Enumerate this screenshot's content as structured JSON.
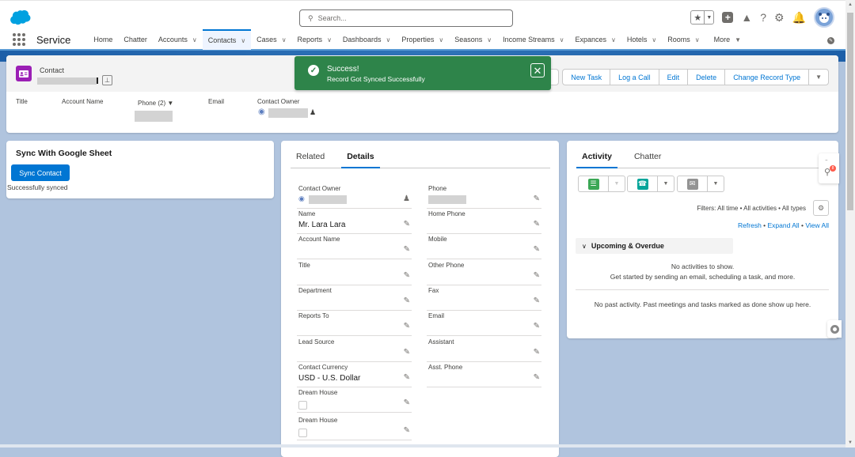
{
  "header": {
    "search_placeholder": "Search...",
    "icons": [
      "favorites-star-icon",
      "favorites-dropdown-icon",
      "global-add-icon",
      "trailhead-icon",
      "help-icon",
      "setup-gear-icon",
      "notifications-bell-icon",
      "user-avatar"
    ]
  },
  "nav": {
    "app_name": "Service",
    "items": [
      {
        "label": "Home",
        "dropdown": false
      },
      {
        "label": "Chatter",
        "dropdown": false
      },
      {
        "label": "Accounts",
        "dropdown": true
      },
      {
        "label": "Contacts",
        "dropdown": true,
        "active": true
      },
      {
        "label": "Cases",
        "dropdown": true
      },
      {
        "label": "Reports",
        "dropdown": true
      },
      {
        "label": "Dashboards",
        "dropdown": true
      },
      {
        "label": "Properties",
        "dropdown": true
      },
      {
        "label": "Seasons",
        "dropdown": true
      },
      {
        "label": "Income Streams",
        "dropdown": true
      },
      {
        "label": "Expances",
        "dropdown": true
      },
      {
        "label": "Hotels",
        "dropdown": true
      },
      {
        "label": "Rooms",
        "dropdown": true
      }
    ],
    "more_label": "More"
  },
  "record": {
    "object_label": "Contact",
    "actions": [
      "New Task",
      "Log a Call",
      "Edit",
      "Delete",
      "Change Record Type"
    ],
    "highlights": {
      "title_label": "Title",
      "account_label": "Account Name",
      "phone_label": "Phone (2)",
      "email_label": "Email",
      "owner_label": "Contact Owner"
    }
  },
  "toast": {
    "title": "Success!",
    "message": "Record Got Synced Successfully",
    "color": "#2e844a"
  },
  "sync": {
    "title": "Sync With Google Sheet",
    "button_label": "Sync Contact",
    "status": "Successfully synced"
  },
  "details": {
    "tabs": [
      "Related",
      "Details"
    ],
    "active_tab": "Details",
    "left_fields": [
      {
        "label": "Contact Owner",
        "value": ""
      },
      {
        "label": "Name",
        "value": "Mr. Lara Lara"
      },
      {
        "label": "Account Name",
        "value": ""
      },
      {
        "label": "Title",
        "value": ""
      },
      {
        "label": "Department",
        "value": ""
      },
      {
        "label": "Reports To",
        "value": ""
      },
      {
        "label": "Lead Source",
        "value": ""
      },
      {
        "label": "Contact Currency",
        "value": "USD - U.S. Dollar"
      },
      {
        "label": "Dream House",
        "value": ""
      },
      {
        "label": "Dream House",
        "value": ""
      }
    ],
    "right_fields": [
      {
        "label": "Phone",
        "value": ""
      },
      {
        "label": "Home Phone",
        "value": ""
      },
      {
        "label": "Mobile",
        "value": ""
      },
      {
        "label": "Other Phone",
        "value": ""
      },
      {
        "label": "Fax",
        "value": ""
      },
      {
        "label": "Email",
        "value": ""
      },
      {
        "label": "Assistant",
        "value": ""
      },
      {
        "label": "Asst. Phone",
        "value": ""
      }
    ]
  },
  "activity": {
    "tabs": [
      "Activity",
      "Chatter"
    ],
    "active_tab": "Activity",
    "filters": "Filters: All time • All activities • All types",
    "links": {
      "refresh": "Refresh",
      "expand_all": "Expand All",
      "view_all": "View All",
      "sep": " • "
    },
    "upcoming_label": "Upcoming & Overdue",
    "no_activities": "No activities to show.",
    "get_started": "Get started by sending an email, scheduling a task, and more.",
    "no_past": "No past activity. Past meetings and tasks marked as done show up here.",
    "publisher_colors": {
      "task": "#3ba755",
      "call": "#06a59a",
      "email": "#939393"
    }
  },
  "utility": {
    "badge": "8"
  },
  "colors": {
    "brand": "#0176d3",
    "background": "#b0c4de",
    "contact_icon": "#9b1fb5"
  }
}
